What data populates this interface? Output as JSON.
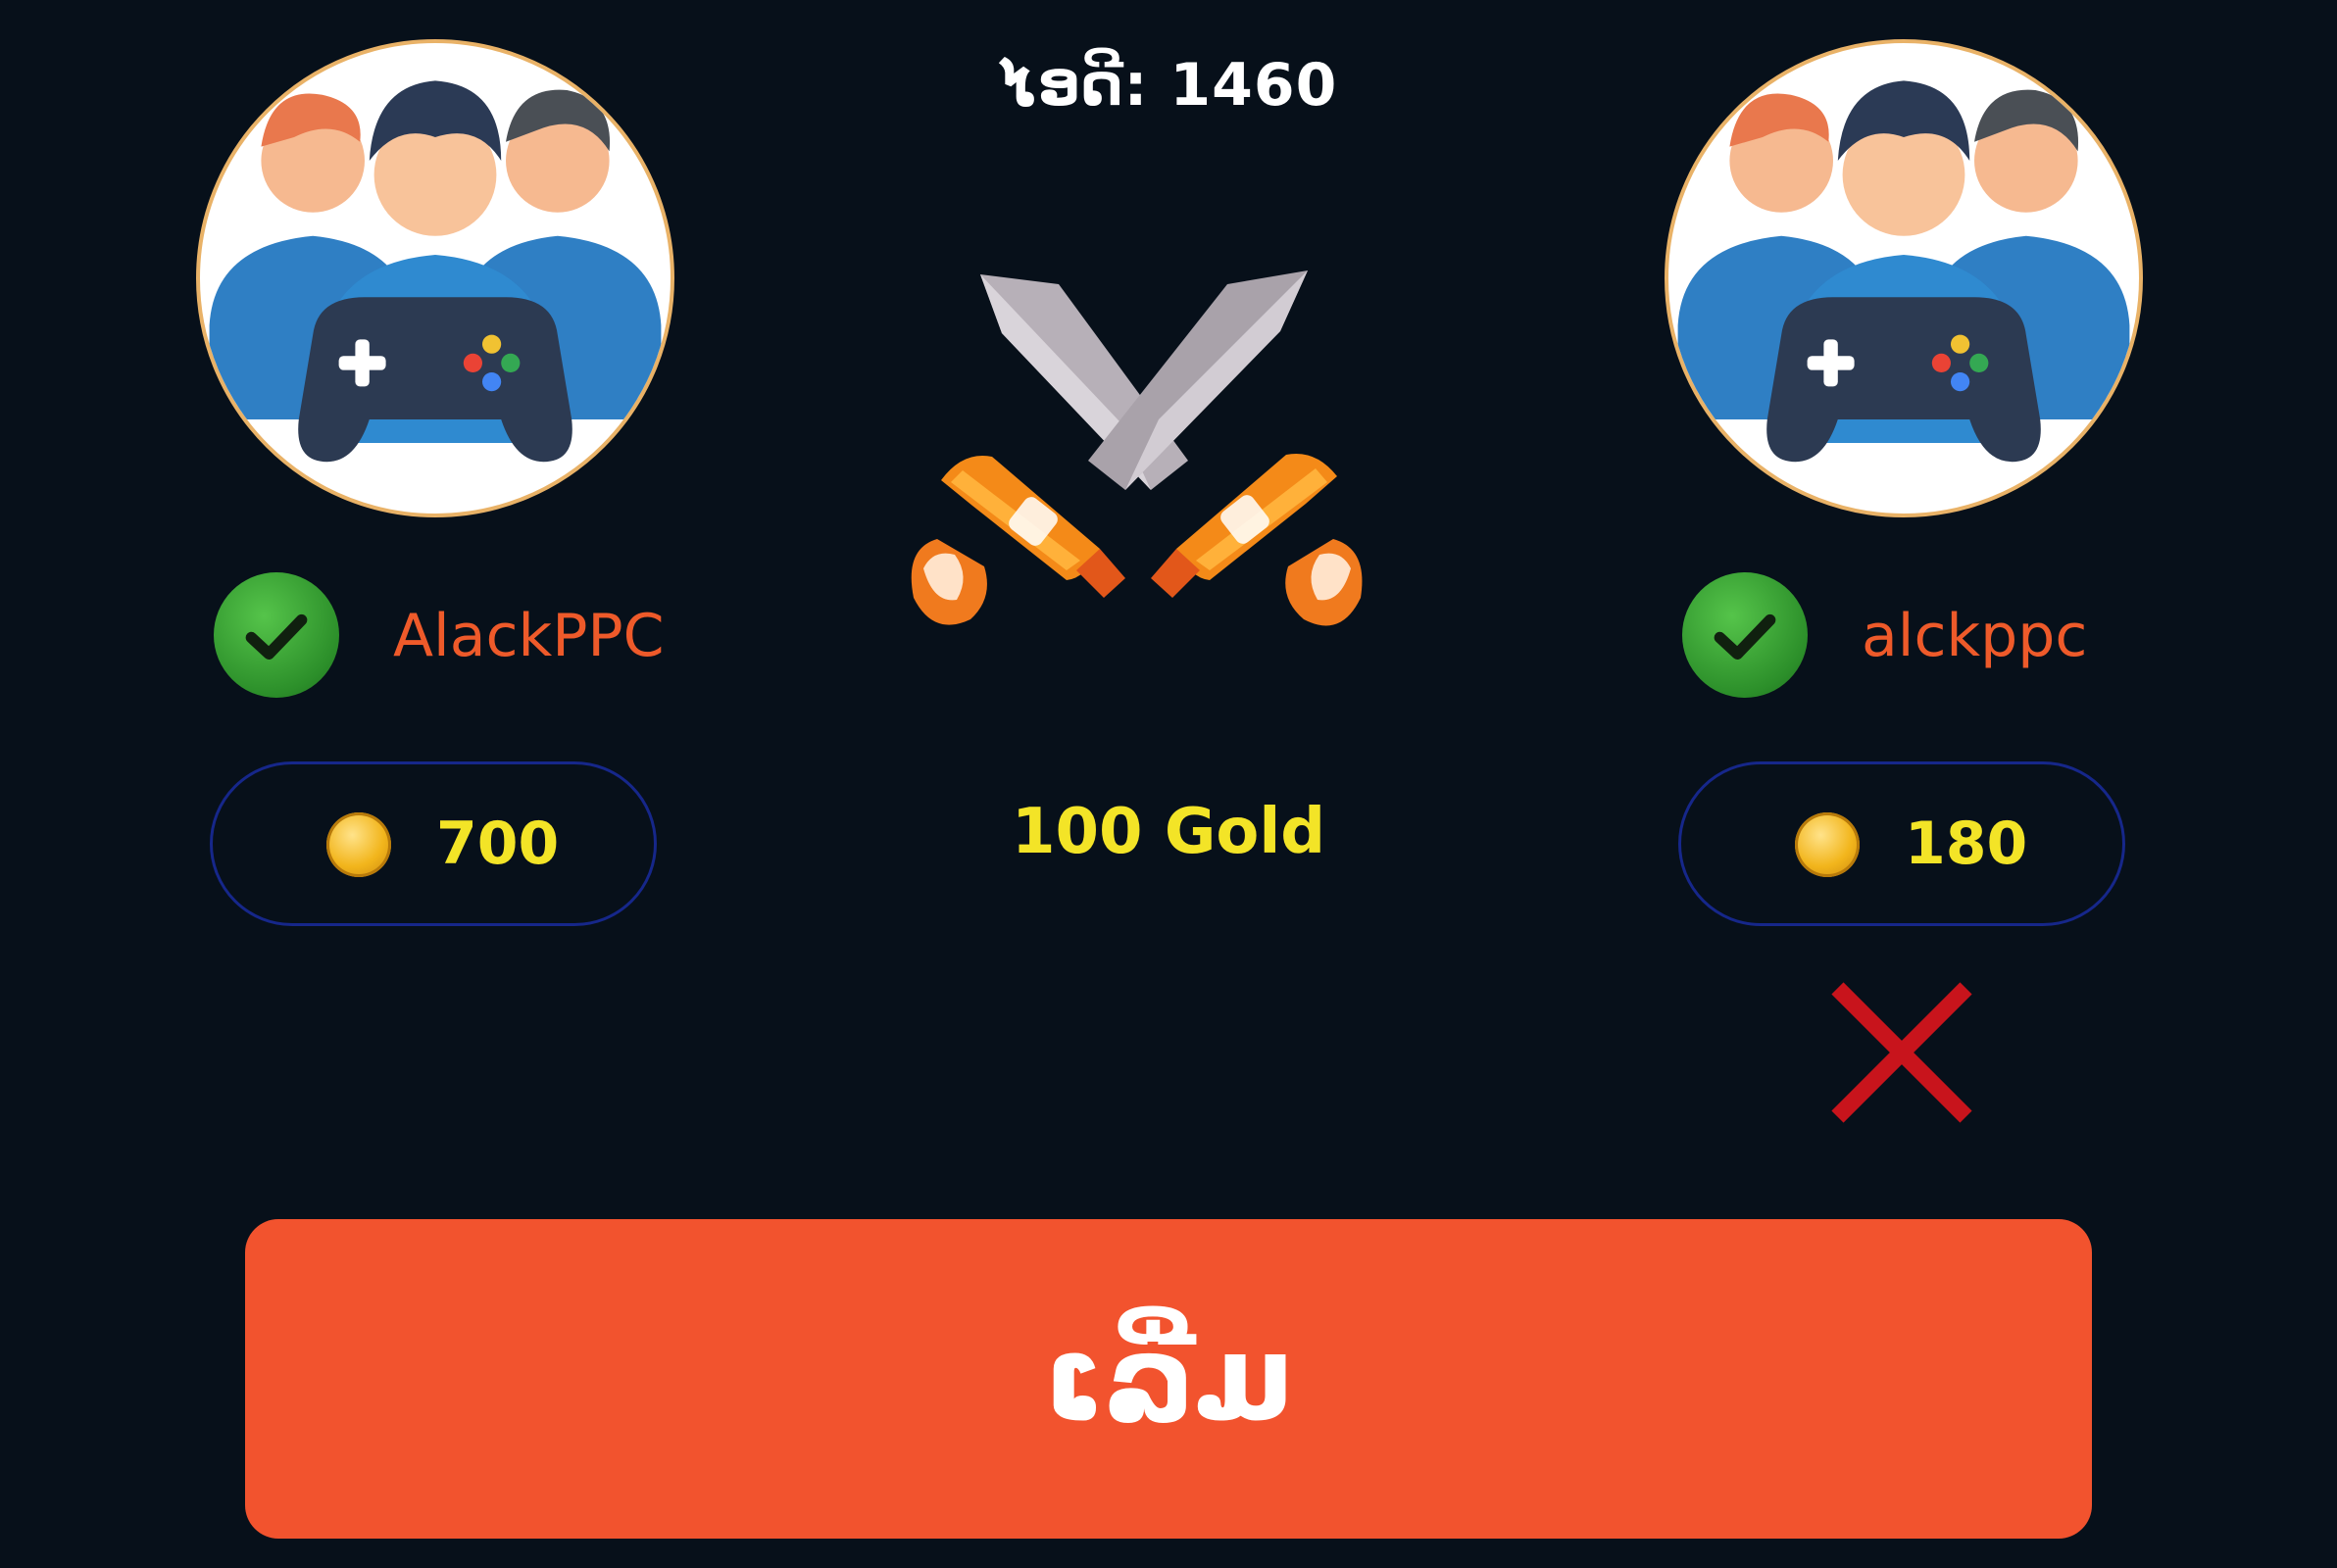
{
  "header": {
    "room_id": "ໄອດີ: 1460"
  },
  "players": [
    {
      "name": "AlackPPC",
      "coins": "700",
      "status": "ready",
      "avatar_icon": "gamers-group-icon"
    },
    {
      "name": "alckppc",
      "coins": "180",
      "status": "ready",
      "avatar_icon": "gamers-group-icon"
    }
  ],
  "match": {
    "versus_icon": "crossed-swords-icon",
    "stake": "100 Gold"
  },
  "actions": {
    "start_label": "ເລີ່ມ",
    "remove_icon": "close-icon"
  },
  "colors": {
    "background": "#07101a",
    "accent": "#f2532e",
    "name_text": "#ee5a2a",
    "gold_text": "#f3e427",
    "ready_badge": "#2c8f2a",
    "pill_border": "#16278a",
    "remove_icon": "#c8141c"
  }
}
